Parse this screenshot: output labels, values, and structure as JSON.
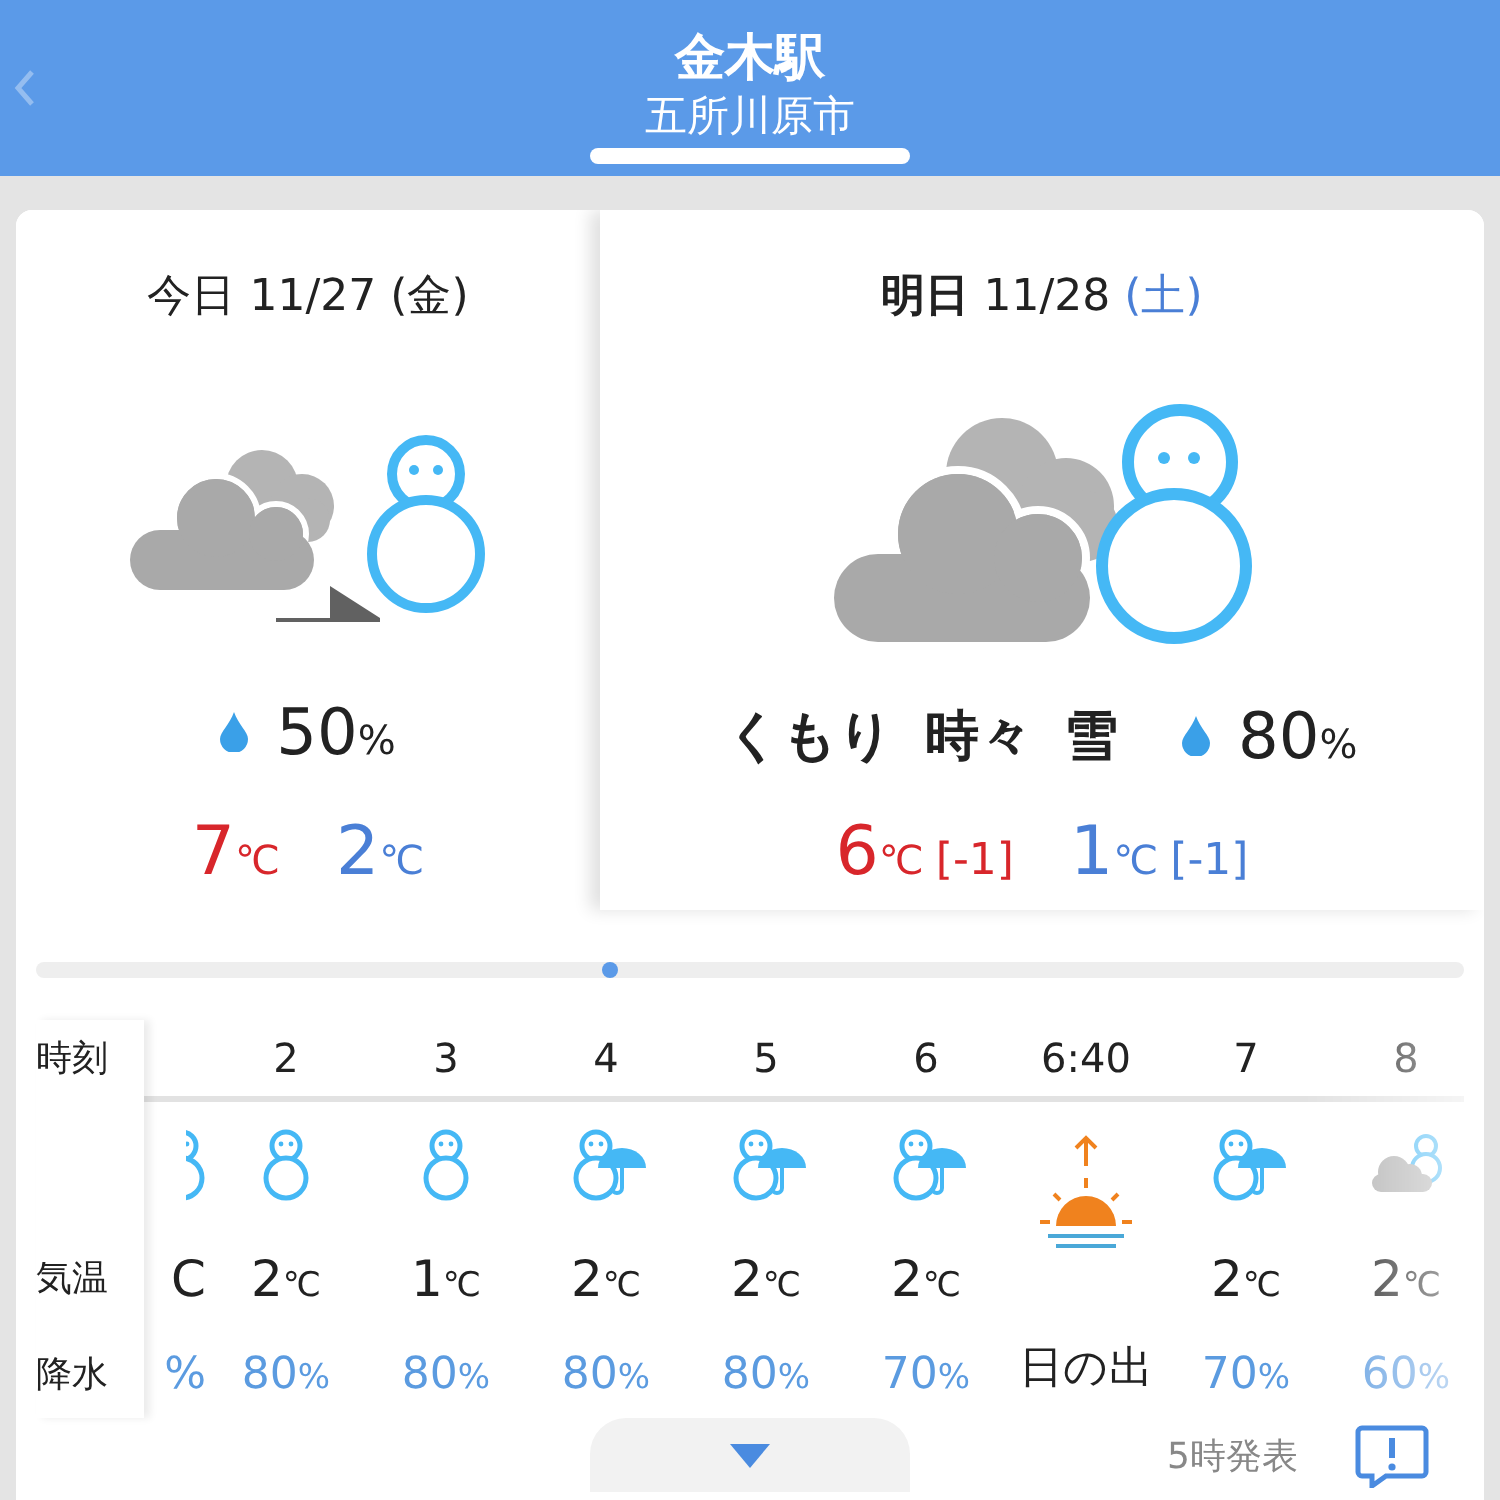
{
  "header": {
    "station": "金木駅",
    "city": "五所川原市"
  },
  "days": [
    {
      "label": "今日",
      "date": "11/27",
      "weekday": "(金)",
      "weekend": false,
      "selected": false,
      "kind": "cloud-then-snow",
      "precip": {
        "value": "50",
        "unit": "%"
      },
      "high": {
        "value": "7",
        "unit": "℃"
      },
      "low": {
        "value": "2",
        "unit": "℃"
      }
    },
    {
      "label": "明日",
      "date": "11/28",
      "weekday": "(土)",
      "weekend": true,
      "selected": true,
      "kind": "cloud-sometimes-snow",
      "condition": "くもり 時々 雪",
      "precip": {
        "value": "80",
        "unit": "%"
      },
      "high": {
        "value": "6",
        "unit": "℃",
        "diff": "[-1]"
      },
      "low": {
        "value": "1",
        "unit": "℃",
        "diff": "[-1]"
      }
    }
  ],
  "hourly": {
    "labels": [
      "時刻",
      "気温",
      "降水"
    ],
    "columns": [
      {
        "kind": "partial",
        "temp_fragment": "C",
        "precip_fragment": "%"
      },
      {
        "kind": "snowman",
        "time": "2",
        "temp": "2",
        "temp_unit": "℃",
        "precip": "80",
        "precip_unit": "%"
      },
      {
        "kind": "snowman",
        "time": "3",
        "temp": "1",
        "temp_unit": "℃",
        "precip": "80",
        "precip_unit": "%"
      },
      {
        "kind": "snowman-umbrella",
        "time": "4",
        "temp": "2",
        "temp_unit": "℃",
        "precip": "80",
        "precip_unit": "%"
      },
      {
        "kind": "snowman-umbrella",
        "time": "5",
        "temp": "2",
        "temp_unit": "℃",
        "precip": "80",
        "precip_unit": "%"
      },
      {
        "kind": "snowman-umbrella",
        "time": "6",
        "temp": "2",
        "temp_unit": "℃",
        "precip": "70",
        "precip_unit": "%"
      },
      {
        "kind": "sunrise",
        "time": "6:40",
        "label": "日の出"
      },
      {
        "kind": "snowman-umbrella",
        "time": "7",
        "temp": "2",
        "temp_unit": "℃",
        "precip": "70",
        "precip_unit": "%"
      },
      {
        "kind": "cloud-snow",
        "time": "8",
        "temp": "2",
        "temp_unit": "℃",
        "precip": "60",
        "precip_unit": "%"
      }
    ]
  },
  "footer": {
    "issued": "5時発表"
  }
}
